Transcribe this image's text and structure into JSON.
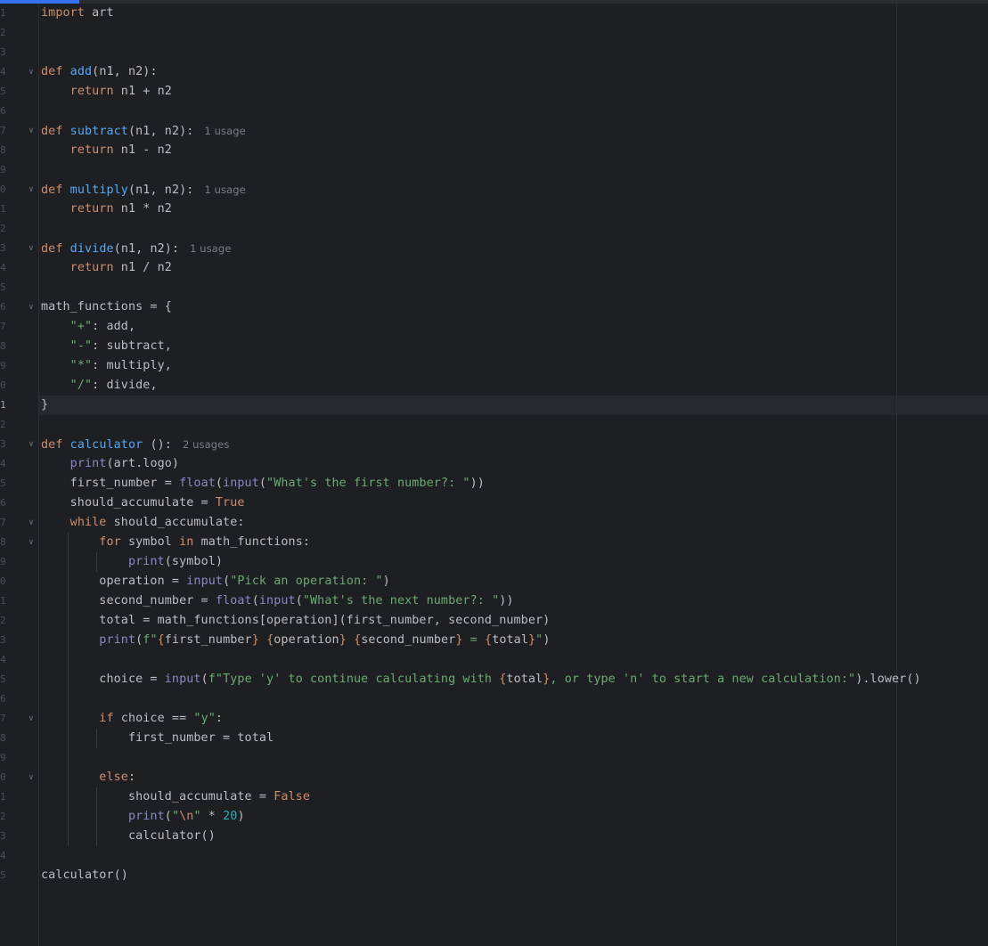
{
  "editor": {
    "language": "python",
    "current_line": 21,
    "colors": {
      "background": "#1e1f22",
      "keyword": "#cf8e6d",
      "function": "#56a8f5",
      "builtin": "#8888c6",
      "string": "#6aab73",
      "number": "#2aacb8",
      "text": "#bcbec4",
      "accent": "#3574f0"
    },
    "lines": [
      {
        "n": "1",
        "code": "import art"
      },
      {
        "n": "2",
        "code": ""
      },
      {
        "n": "3",
        "code": ""
      },
      {
        "n": "4",
        "code": "def add(n1, n2):",
        "fold": true
      },
      {
        "n": "5",
        "code": "    return n1 + n2"
      },
      {
        "n": "6",
        "code": ""
      },
      {
        "n": "7",
        "code": "def subtract(n1, n2):",
        "fold": true,
        "hint": "1 usage"
      },
      {
        "n": "8",
        "code": "    return n1 - n2"
      },
      {
        "n": "9",
        "code": ""
      },
      {
        "n": "0",
        "code": "def multiply(n1, n2):",
        "fold": true,
        "hint": "1 usage"
      },
      {
        "n": "1",
        "code": "    return n1 * n2"
      },
      {
        "n": "2",
        "code": ""
      },
      {
        "n": "3",
        "code": "def divide(n1, n2):",
        "fold": true,
        "hint": "1 usage"
      },
      {
        "n": "4",
        "code": "    return n1 / n2"
      },
      {
        "n": "5",
        "code": ""
      },
      {
        "n": "6",
        "code": "math_functions = {",
        "fold": true
      },
      {
        "n": "7",
        "code": "    \"+\": add,"
      },
      {
        "n": "8",
        "code": "    \"-\": subtract,"
      },
      {
        "n": "9",
        "code": "    \"*\": multiply,"
      },
      {
        "n": "0",
        "code": "    \"/\": divide,"
      },
      {
        "n": "1",
        "code": "}"
      },
      {
        "n": "2",
        "code": ""
      },
      {
        "n": "3",
        "code": "def calculator ():",
        "fold": true,
        "hint": "2 usages"
      },
      {
        "n": "4",
        "code": "    print(art.logo)"
      },
      {
        "n": "5",
        "code": "    first_number = float(input(\"What's the first number?: \"))"
      },
      {
        "n": "6",
        "code": "    should_accumulate = True"
      },
      {
        "n": "7",
        "code": "    while should_accumulate:",
        "fold": true
      },
      {
        "n": "8",
        "code": "        for symbol in math_functions:",
        "fold": true
      },
      {
        "n": "9",
        "code": "            print(symbol)"
      },
      {
        "n": "0",
        "code": "        operation = input(\"Pick an operation: \")"
      },
      {
        "n": "1",
        "code": "        second_number = float(input(\"What's the next number?: \"))"
      },
      {
        "n": "2",
        "code": "        total = math_functions[operation](first_number, second_number)"
      },
      {
        "n": "3",
        "code": "        print(f\"{first_number} {operation} {second_number} = {total}\")"
      },
      {
        "n": "4",
        "code": ""
      },
      {
        "n": "5",
        "code": "        choice = input(f\"Type 'y' to continue calculating with {total}, or type 'n' to start a new calculation:\").lower()"
      },
      {
        "n": "6",
        "code": ""
      },
      {
        "n": "7",
        "code": "        if choice == \"y\":",
        "fold": true
      },
      {
        "n": "8",
        "code": "            first_number = total"
      },
      {
        "n": "9",
        "code": ""
      },
      {
        "n": "0",
        "code": "        else:",
        "fold": true
      },
      {
        "n": "1",
        "code": "            should_accumulate = False"
      },
      {
        "n": "2",
        "code": "            print(\"\\n\" * 20)"
      },
      {
        "n": "3",
        "code": "            calculator()"
      },
      {
        "n": "4",
        "code": ""
      },
      {
        "n": "5",
        "code": "calculator()"
      }
    ]
  }
}
